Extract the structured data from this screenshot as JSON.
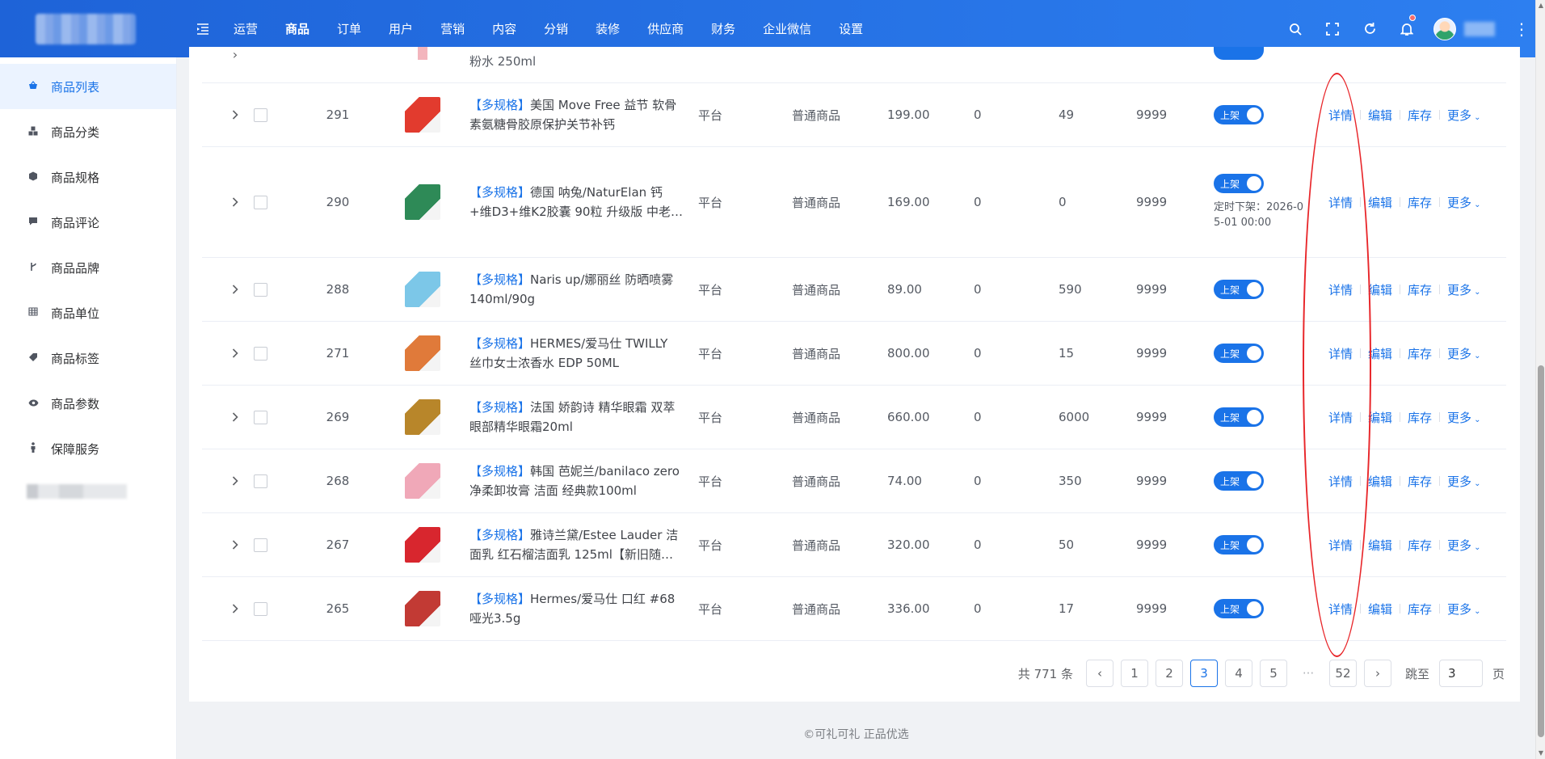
{
  "topnav": {
    "items": [
      "运营",
      "商品",
      "订单",
      "用户",
      "营销",
      "内容",
      "分销",
      "装修",
      "供应商",
      "财务",
      "企业微信",
      "设置"
    ],
    "active_index": 1
  },
  "sidebar": {
    "items": [
      {
        "label": "商品列表",
        "icon": "basket-icon",
        "active": true
      },
      {
        "label": "商品分类",
        "icon": "cubes-icon"
      },
      {
        "label": "商品规格",
        "icon": "cube-icon"
      },
      {
        "label": "商品评论",
        "icon": "comment-icon"
      },
      {
        "label": "商品品牌",
        "icon": "branch-icon"
      },
      {
        "label": "商品单位",
        "icon": "grid-icon"
      },
      {
        "label": "商品标签",
        "icon": "tag-icon"
      },
      {
        "label": "商品参数",
        "icon": "eye-icon"
      },
      {
        "label": "保障服务",
        "icon": "person-icon"
      }
    ]
  },
  "partial_row": {
    "name_tail": "粉水 250ml"
  },
  "table": {
    "rows": [
      {
        "id": "291",
        "tag": "【多规格】",
        "name": "美国 Move Free 益节 软骨素氨糖骨胶原保护关节补钙",
        "platform": "平台",
        "type": "普通商品",
        "price": "199.00",
        "sales": "0",
        "stock": "49",
        "virtual": "9999",
        "status": "上架",
        "schedule": "",
        "thumb_color": "#e23b2e"
      },
      {
        "id": "290",
        "tag": "【多规格】",
        "name": "德国 呐兔/NaturElan 钙+维D3+维K2胶囊 90粒 升级版 中老…",
        "platform": "平台",
        "type": "普通商品",
        "price": "169.00",
        "sales": "0",
        "stock": "0",
        "virtual": "9999",
        "status": "上架",
        "schedule": "定时下架：2026-05-01 00:00",
        "thumb_color": "#2e8a57"
      },
      {
        "id": "288",
        "tag": "【多规格】",
        "name": "Naris up/娜丽丝 防晒喷雾 140ml/90g",
        "platform": "平台",
        "type": "普通商品",
        "price": "89.00",
        "sales": "0",
        "stock": "590",
        "virtual": "9999",
        "status": "上架",
        "schedule": "",
        "thumb_color": "#7cc7e8"
      },
      {
        "id": "271",
        "tag": "【多规格】",
        "name": "HERMES/爱马仕 TWILLY 丝巾女士浓香水 EDP 50ML",
        "platform": "平台",
        "type": "普通商品",
        "price": "800.00",
        "sales": "0",
        "stock": "15",
        "virtual": "9999",
        "status": "上架",
        "schedule": "",
        "thumb_color": "#e07a3a"
      },
      {
        "id": "269",
        "tag": "【多规格】",
        "name": "法国 娇韵诗 精华眼霜 双萃眼部精华眼霜20ml",
        "platform": "平台",
        "type": "普通商品",
        "price": "660.00",
        "sales": "0",
        "stock": "6000",
        "virtual": "9999",
        "status": "上架",
        "schedule": "",
        "thumb_color": "#b8862a"
      },
      {
        "id": "268",
        "tag": "【多规格】",
        "name": "韩国 芭妮兰/banilaco zero 净柔卸妆膏 洁面 经典款100ml",
        "platform": "平台",
        "type": "普通商品",
        "price": "74.00",
        "sales": "0",
        "stock": "350",
        "virtual": "9999",
        "status": "上架",
        "schedule": "",
        "thumb_color": "#f0a8b8"
      },
      {
        "id": "267",
        "tag": "【多规格】",
        "name": "雅诗兰黛/Estee Lauder 洁面乳 红石榴洁面乳 125ml【新旧随…",
        "platform": "平台",
        "type": "普通商品",
        "price": "320.00",
        "sales": "0",
        "stock": "50",
        "virtual": "9999",
        "status": "上架",
        "schedule": "",
        "thumb_color": "#d8262e"
      },
      {
        "id": "265",
        "tag": "【多规格】",
        "name": "Hermes/爱马仕 口红 #68 哑光3.5g",
        "platform": "平台",
        "type": "普通商品",
        "price": "336.00",
        "sales": "0",
        "stock": "17",
        "virtual": "9999",
        "status": "上架",
        "schedule": "",
        "thumb_color": "#c23a34"
      }
    ],
    "ops": {
      "detail": "详情",
      "edit": "编辑",
      "stock": "库存",
      "more": "更多"
    }
  },
  "pagination": {
    "total": "共 771 条",
    "pages": [
      "1",
      "2",
      "3",
      "4",
      "5"
    ],
    "current": "3",
    "ellipsis": "···",
    "last": "52",
    "jump_label": "跳至",
    "jump_value": "3",
    "page_suffix": "页"
  },
  "footer": "©可礼可礼 正品优选",
  "colors": {
    "accent": "#1a73e8",
    "topbar": "#2d7ff0",
    "annotation": "#e8262a"
  }
}
